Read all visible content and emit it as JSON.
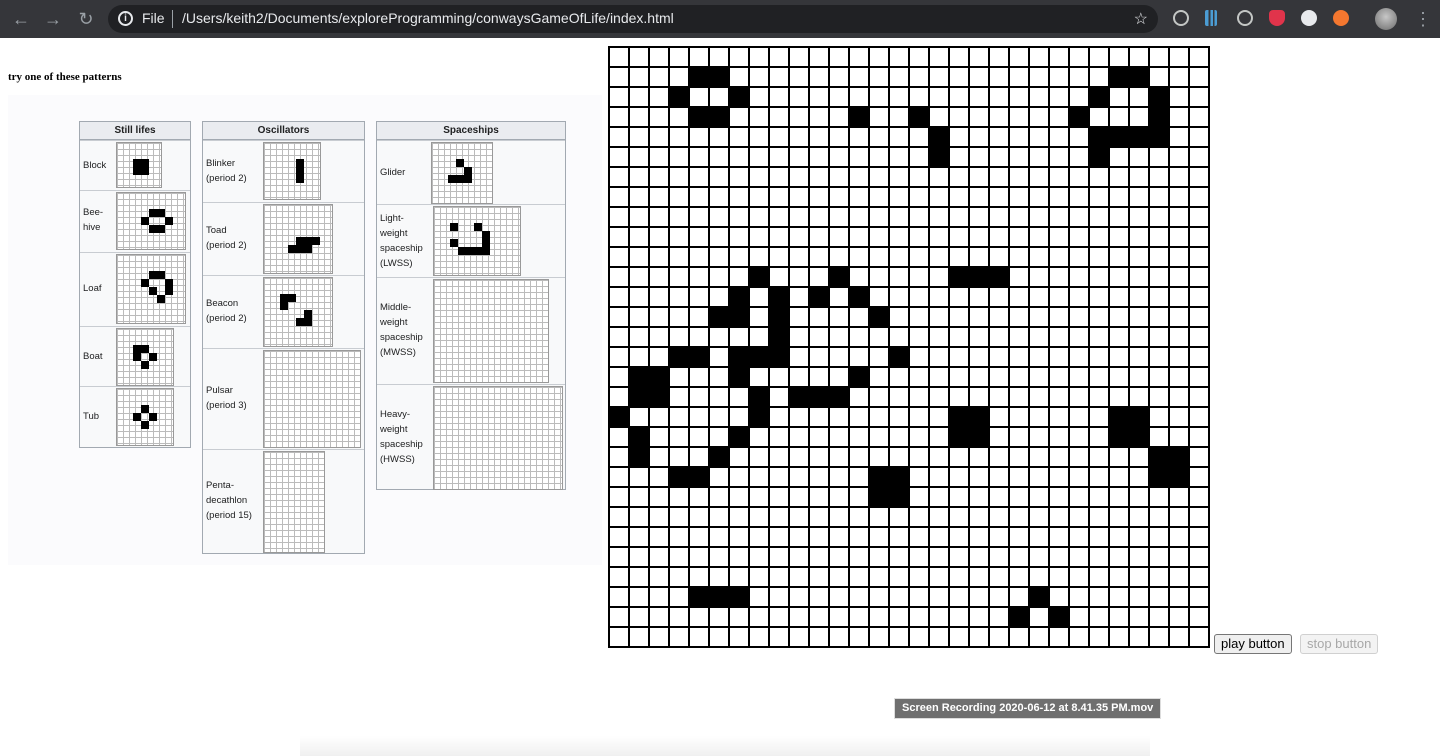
{
  "browser": {
    "scheme": "File",
    "url": "/Users/keith2/Documents/exploreProgramming/conwaysGameOfLife/index.html",
    "icons": [
      "back-icon",
      "forward-icon",
      "reload-icon",
      "info-icon",
      "star-icon",
      "globe-extension-icon",
      "bar-extension-icon",
      "react-extension-icon",
      "shield-extension-icon",
      "circle-extension-icon",
      "fox-extension-icon",
      "avatar",
      "menu-icon"
    ]
  },
  "page": {
    "prompt": "try one of these patterns",
    "play_label": "play button",
    "stop_label": "stop button",
    "tooltip": "Screen Recording 2020-06-12 at 8.41.35 PM.mov"
  },
  "patterns": {
    "still_lifes": {
      "header": "Still lifes",
      "items": [
        "Block",
        "Bee-\nhive",
        "Loaf",
        "Boat",
        "Tub"
      ]
    },
    "oscillators": {
      "header": "Oscillators",
      "items": [
        "Blinker\n(period 2)",
        "Toad\n(period 2)",
        "Beacon\n(period 2)",
        "Pulsar\n(period 3)",
        "Penta-\ndecathlon\n(period 15)"
      ]
    },
    "spaceships": {
      "header": "Spaceships",
      "items": [
        "Glider",
        "Light-\nweight\nspaceship\n(LWSS)",
        "Middle-\nweight\nspaceship\n(MWSS)",
        "Heavy-\nweight\nspaceship\n(HWSS)"
      ]
    }
  },
  "board": {
    "cols": 30,
    "rows": 30,
    "live_color": "#000000",
    "dead_color": "#ffffff",
    "live_cells": [
      [
        4,
        1
      ],
      [
        5,
        1
      ],
      [
        25,
        1
      ],
      [
        26,
        1
      ],
      [
        3,
        2
      ],
      [
        6,
        2
      ],
      [
        24,
        2
      ],
      [
        27,
        2
      ],
      [
        4,
        3
      ],
      [
        5,
        3
      ],
      [
        12,
        3
      ],
      [
        15,
        3
      ],
      [
        23,
        3
      ],
      [
        27,
        3
      ],
      [
        16,
        4
      ],
      [
        24,
        4
      ],
      [
        25,
        4
      ],
      [
        26,
        4
      ],
      [
        27,
        4
      ],
      [
        16,
        5
      ],
      [
        24,
        5
      ],
      [
        7,
        11
      ],
      [
        11,
        11
      ],
      [
        17,
        11
      ],
      [
        18,
        11
      ],
      [
        19,
        11
      ],
      [
        6,
        12
      ],
      [
        8,
        12
      ],
      [
        10,
        12
      ],
      [
        12,
        12
      ],
      [
        5,
        13
      ],
      [
        6,
        13
      ],
      [
        8,
        13
      ],
      [
        13,
        13
      ],
      [
        8,
        14
      ],
      [
        3,
        15
      ],
      [
        4,
        15
      ],
      [
        6,
        15
      ],
      [
        7,
        15
      ],
      [
        8,
        15
      ],
      [
        14,
        15
      ],
      [
        1,
        16
      ],
      [
        2,
        16
      ],
      [
        6,
        16
      ],
      [
        12,
        16
      ],
      [
        1,
        17
      ],
      [
        2,
        17
      ],
      [
        7,
        17
      ],
      [
        9,
        17
      ],
      [
        10,
        17
      ],
      [
        11,
        17
      ],
      [
        0,
        18
      ],
      [
        7,
        18
      ],
      [
        17,
        18
      ],
      [
        18,
        18
      ],
      [
        25,
        18
      ],
      [
        26,
        18
      ],
      [
        1,
        19
      ],
      [
        6,
        19
      ],
      [
        17,
        19
      ],
      [
        18,
        19
      ],
      [
        25,
        19
      ],
      [
        26,
        19
      ],
      [
        1,
        20
      ],
      [
        5,
        20
      ],
      [
        27,
        20
      ],
      [
        28,
        20
      ],
      [
        3,
        21
      ],
      [
        4,
        21
      ],
      [
        13,
        21
      ],
      [
        14,
        21
      ],
      [
        27,
        21
      ],
      [
        28,
        21
      ],
      [
        13,
        22
      ],
      [
        14,
        22
      ],
      [
        4,
        27
      ],
      [
        5,
        27
      ],
      [
        6,
        27
      ],
      [
        21,
        27
      ],
      [
        20,
        28
      ],
      [
        22,
        28
      ]
    ]
  }
}
